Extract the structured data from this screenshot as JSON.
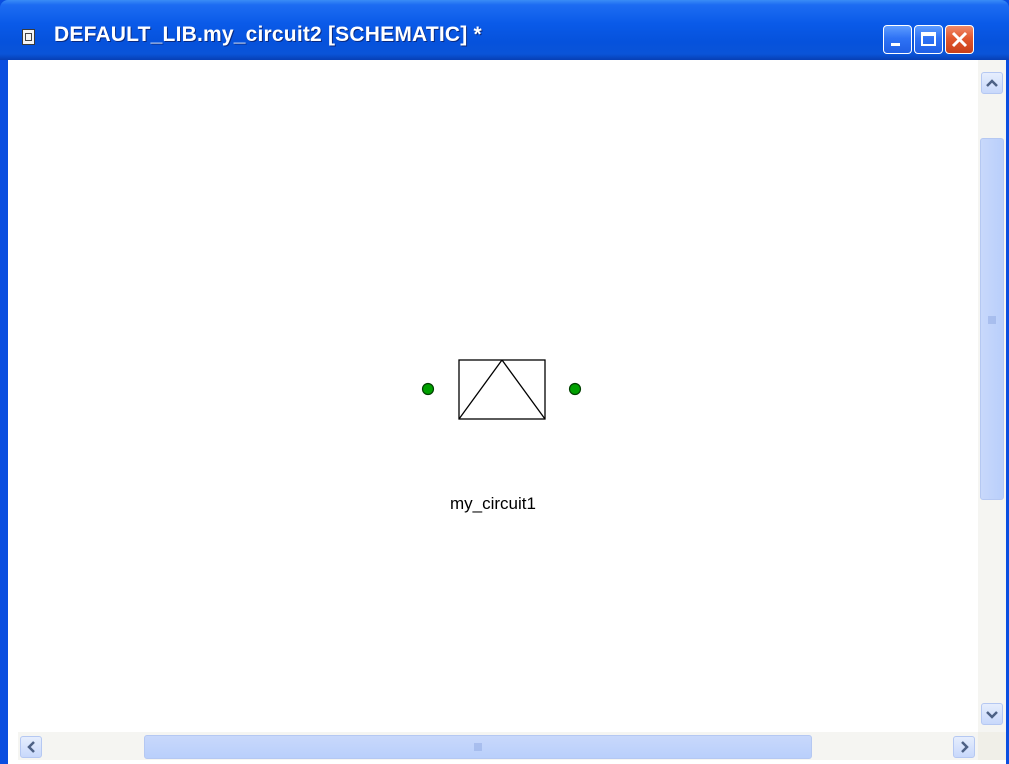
{
  "window": {
    "title": "DEFAULT_LIB.my_circuit2 [SCHEMATIC] *",
    "controls": {
      "minimize": "minimize-icon",
      "maximize": "maximize-icon",
      "close": "close-icon"
    }
  },
  "schematic": {
    "component": {
      "label": "my_circuit1",
      "port_color": "#00a000"
    }
  },
  "scrollbars": {
    "vertical": {
      "up": "arrow-up-icon",
      "down": "arrow-down-icon"
    },
    "horizontal": {
      "left": "arrow-left-icon",
      "right": "arrow-right-icon"
    }
  },
  "colors": {
    "titlebar": "#0a5ae8",
    "close_button": "#e2582e",
    "canvas": "#ffffff",
    "scroll_thumb": "#c8d8fb"
  }
}
